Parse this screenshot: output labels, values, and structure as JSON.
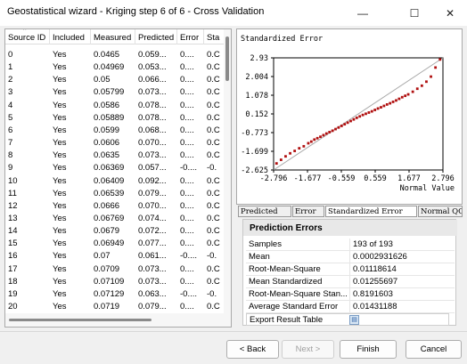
{
  "window": {
    "title": "Geostatistical wizard - Kriging step 6 of 6 - Cross Validation",
    "min_glyph": "—",
    "max_glyph": "☐",
    "close_glyph": "✕"
  },
  "table": {
    "columns": [
      "Source ID",
      "Included",
      "Measured",
      "Predicted",
      "Error",
      "Sta"
    ],
    "rows": [
      [
        "0",
        "Yes",
        "0.0465",
        "0.059...",
        "0....",
        "0.C"
      ],
      [
        "1",
        "Yes",
        "0.04969",
        "0.053...",
        "0....",
        "0.C"
      ],
      [
        "2",
        "Yes",
        "0.05",
        "0.066...",
        "0....",
        "0.C"
      ],
      [
        "3",
        "Yes",
        "0.05799",
        "0.073...",
        "0....",
        "0.C"
      ],
      [
        "4",
        "Yes",
        "0.0586",
        "0.078...",
        "0....",
        "0.C"
      ],
      [
        "5",
        "Yes",
        "0.05889",
        "0.078...",
        "0....",
        "0.C"
      ],
      [
        "6",
        "Yes",
        "0.0599",
        "0.068...",
        "0....",
        "0.C"
      ],
      [
        "7",
        "Yes",
        "0.0606",
        "0.070...",
        "0....",
        "0.C"
      ],
      [
        "8",
        "Yes",
        "0.0635",
        "0.073...",
        "0....",
        "0.C"
      ],
      [
        "9",
        "Yes",
        "0.06369",
        "0.057...",
        "-0....",
        "-0."
      ],
      [
        "10",
        "Yes",
        "0.06409",
        "0.092...",
        "0....",
        "0.C"
      ],
      [
        "11",
        "Yes",
        "0.06539",
        "0.079...",
        "0....",
        "0.C"
      ],
      [
        "12",
        "Yes",
        "0.0666",
        "0.070...",
        "0....",
        "0.C"
      ],
      [
        "13",
        "Yes",
        "0.06769",
        "0.074...",
        "0....",
        "0.C"
      ],
      [
        "14",
        "Yes",
        "0.0679",
        "0.072...",
        "0....",
        "0.C"
      ],
      [
        "15",
        "Yes",
        "0.06949",
        "0.077...",
        "0....",
        "0.C"
      ],
      [
        "16",
        "Yes",
        "0.07",
        "0.061...",
        "-0....",
        "-0."
      ],
      [
        "17",
        "Yes",
        "0.0709",
        "0.073...",
        "0....",
        "0.C"
      ],
      [
        "18",
        "Yes",
        "0.07109",
        "0.073...",
        "0....",
        "0.C"
      ],
      [
        "19",
        "Yes",
        "0.07129",
        "0.063...",
        "-0....",
        "-0."
      ],
      [
        "20",
        "Yes",
        "0.0719",
        "0.079...",
        "0....",
        "0.C"
      ]
    ]
  },
  "chart_data": {
    "type": "scatter",
    "title": "Standardized Error",
    "xlabel": "Normal Value",
    "ylabel": "",
    "x_ticks": [
      "-2.796",
      "-1.677",
      "-0.559",
      "0.559",
      "1.677",
      "2.796"
    ],
    "y_ticks": [
      "2.93",
      "2.004",
      "1.078",
      "0.152",
      "-0.773",
      "-1.699",
      "-2.625"
    ],
    "xlim": [
      -2.796,
      2.796
    ],
    "ylim": [
      -2.625,
      2.93
    ],
    "reference_line": {
      "from": [
        -2.796,
        -2.625
      ],
      "to": [
        2.796,
        2.93
      ]
    },
    "point_color": "#b01010",
    "series": [
      {
        "x": [
          -2.7,
          -2.55,
          -2.4,
          -2.25,
          -2.1,
          -1.95,
          -1.8,
          -1.65,
          -1.55,
          -1.45,
          -1.35,
          -1.25,
          -1.15,
          -1.05,
          -0.95,
          -0.85,
          -0.75,
          -0.65,
          -0.55,
          -0.45,
          -0.35,
          -0.25,
          -0.15,
          -0.05,
          0.05,
          0.15,
          0.25,
          0.35,
          0.45,
          0.55,
          0.65,
          0.75,
          0.85,
          0.95,
          1.05,
          1.15,
          1.25,
          1.35,
          1.45,
          1.55,
          1.65,
          1.8,
          1.95,
          2.1,
          2.25,
          2.4,
          2.55,
          2.7
        ],
        "y": [
          -2.3,
          -2.12,
          -1.95,
          -1.8,
          -1.68,
          -1.55,
          -1.45,
          -1.3,
          -1.22,
          -1.12,
          -1.05,
          -0.98,
          -0.9,
          -0.82,
          -0.75,
          -0.68,
          -0.6,
          -0.52,
          -0.44,
          -0.36,
          -0.28,
          -0.2,
          -0.12,
          -0.04,
          0.03,
          0.1,
          0.16,
          0.22,
          0.28,
          0.35,
          0.42,
          0.48,
          0.55,
          0.62,
          0.68,
          0.75,
          0.82,
          0.9,
          0.98,
          1.05,
          1.12,
          1.25,
          1.4,
          1.55,
          1.75,
          2.0,
          2.45,
          2.85
        ]
      }
    ]
  },
  "tabs": [
    "Predicted",
    "Error",
    "Standardized Error",
    "Normal QQ"
  ],
  "prediction_errors": {
    "header": "Prediction Errors",
    "rows": [
      {
        "label": "Samples",
        "value": "193 of 193"
      },
      {
        "label": "Mean",
        "value": "0.0002931626"
      },
      {
        "label": "Root-Mean-Square",
        "value": "0.01118614"
      },
      {
        "label": "Mean Standardized",
        "value": "0.01255697"
      },
      {
        "label": "Root-Mean-Square Stan...",
        "value": "0.8191603"
      },
      {
        "label": "Average Standard Error",
        "value": "0.01431188"
      }
    ],
    "export_label": "Export Result Table",
    "export_icon_glyph": "▤"
  },
  "buttons": {
    "back": "< Back",
    "next": "Next >",
    "finish": "Finish",
    "cancel": "Cancel"
  },
  "colors": {
    "points": "#b01010",
    "reference_line": "#a8a8a8"
  }
}
